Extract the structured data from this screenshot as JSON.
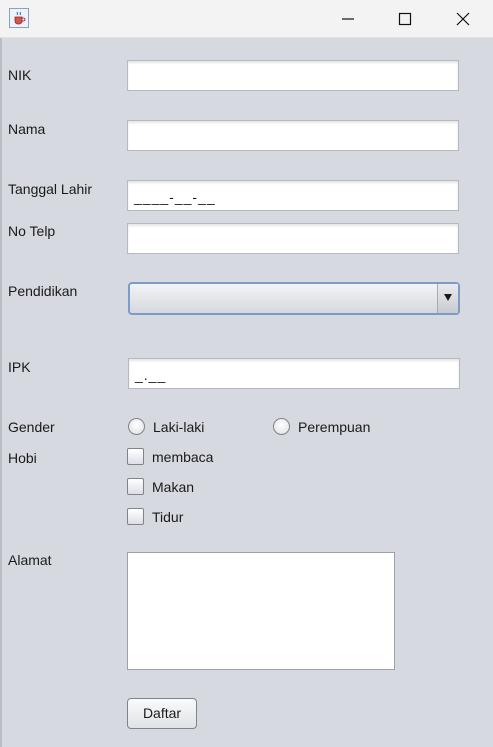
{
  "window": {
    "icons": {
      "app": "java-cup-icon",
      "minimize": "minimize-icon",
      "maximize": "maximize-icon",
      "close": "close-icon"
    }
  },
  "form": {
    "nik": {
      "label": "NIK",
      "value": ""
    },
    "nama": {
      "label": "Nama",
      "value": ""
    },
    "tanggal_lahir": {
      "label": "Tanggal Lahir",
      "value": "____-__-__"
    },
    "no_telp": {
      "label": "No Telp",
      "value": ""
    },
    "pendidikan": {
      "label": "Pendidikan",
      "selected": ""
    },
    "ipk": {
      "label": "IPK",
      "value": "_.__"
    },
    "gender": {
      "label": "Gender",
      "options": [
        "Laki-laki",
        "Perempuan"
      ]
    },
    "hobi": {
      "label": "Hobi",
      "options": [
        "membaca",
        "Makan",
        "Tidur"
      ]
    },
    "alamat": {
      "label": "Alamat",
      "value": ""
    },
    "submit_label": "Daftar"
  },
  "colors": {
    "window_bg": "#d6d9df",
    "titlebar_bg": "#f3f3f3",
    "combo_border": "#7d9bc6"
  }
}
